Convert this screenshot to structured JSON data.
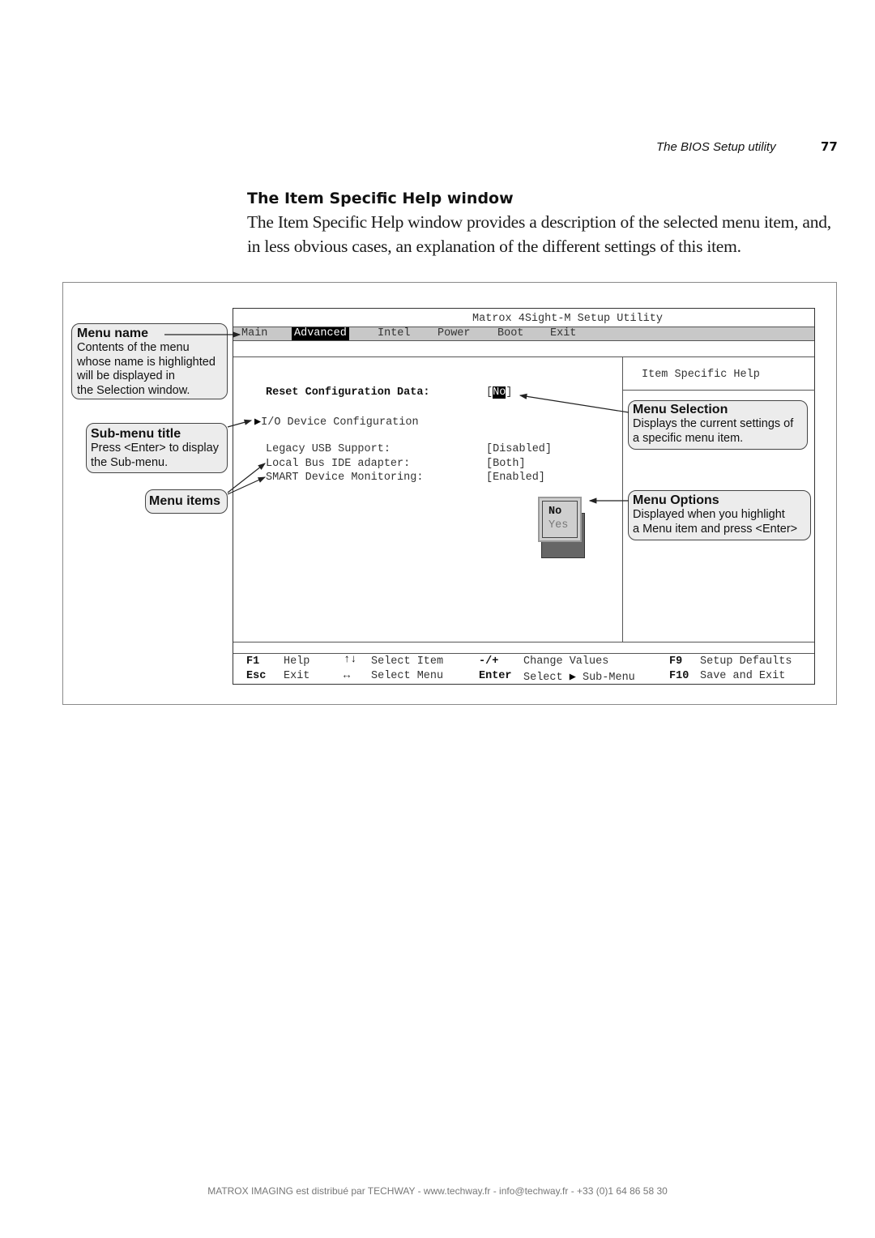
{
  "header": {
    "running_title": "The BIOS Setup utility",
    "page_number": "77"
  },
  "section": {
    "title": "The Item Specific Help window",
    "intro_prefix": "The ",
    "intro_term": "Item Specific Help",
    "intro_rest": " window provides a description of the selected menu item, and, in less obvious cases, an explanation of the different settings of this item."
  },
  "bios": {
    "title": "Matrox 4Sight-M Setup Utility",
    "menu_tabs": [
      {
        "label": "Main",
        "active": false
      },
      {
        "label": "Advanced",
        "active": true
      },
      {
        "label": "Intel",
        "active": false
      },
      {
        "label": "Power",
        "active": false
      },
      {
        "label": "Boot",
        "active": false
      },
      {
        "label": "Exit",
        "active": false
      }
    ],
    "reset_label": "Reset Configuration Data:",
    "reset_value_open": "[",
    "reset_value": "No",
    "reset_value_close": "]",
    "submenu_label": "I/O Device Configuration",
    "items": [
      {
        "label": "Legacy USB Support:",
        "value": "[Disabled]"
      },
      {
        "label": "Local Bus IDE adapter:",
        "value": "[Both]"
      },
      {
        "label": "SMART Device Monitoring:",
        "value": "[Enabled]"
      }
    ],
    "popup_options": [
      "No",
      "Yes"
    ],
    "help_header": "Item Specific Help",
    "keys": [
      {
        "key": "F1",
        "action": "Help"
      },
      {
        "key": "↑↓",
        "action": "Select Item"
      },
      {
        "key": "-/+",
        "action": "Change Values"
      },
      {
        "key": "F9",
        "action": "Setup Defaults"
      },
      {
        "key": "Esc",
        "action": "Exit"
      },
      {
        "key": "↔",
        "action": "Select Menu"
      },
      {
        "key": "Enter",
        "action": "Select",
        "action_suffix": "Sub-Menu"
      },
      {
        "key": "F10",
        "action": "Save and Exit"
      }
    ]
  },
  "callouts": {
    "menu_name": {
      "title": "Menu name",
      "desc": [
        "Contents of the menu",
        "whose name is highlighted",
        "will be displayed in",
        "the Selection window."
      ]
    },
    "submenu_title": {
      "title": "Sub-menu title",
      "desc": [
        "Press <Enter> to display",
        "the Sub-menu."
      ]
    },
    "menu_items": {
      "title": "Menu items"
    },
    "menu_selection": {
      "title": "Menu Selection",
      "desc": [
        "Displays the current settings of",
        "a specific menu item."
      ]
    },
    "menu_options": {
      "title": "Menu Options",
      "desc": [
        "Displayed when you highlight",
        "a Menu item and press <Enter>"
      ]
    }
  },
  "footer": {
    "text": "MATROX IMAGING est distribué par TECHWAY - www.techway.fr - info@techway.fr - +33 (0)1 64 86 58 30"
  }
}
